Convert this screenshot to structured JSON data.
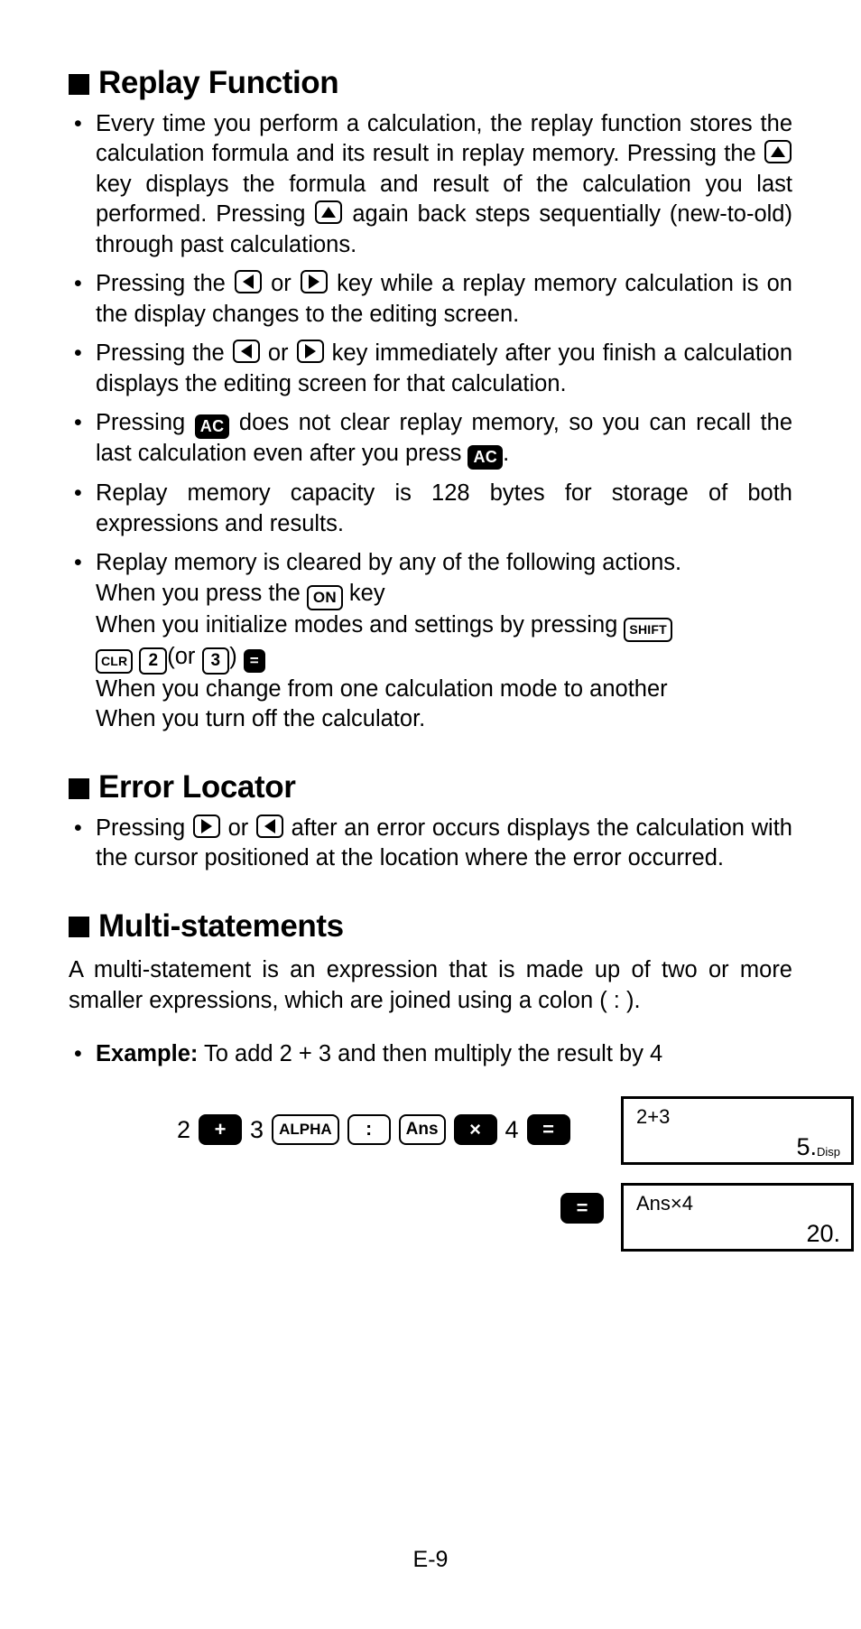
{
  "page": {
    "footer": "E-9"
  },
  "sections": {
    "replay": {
      "heading": "Replay Function",
      "bullets": {
        "b1_p1": "Every time you perform a calculation, the replay function stores the calculation formula and its result in replay memory. Pressing the",
        "b1_p2": "key displays the formula and result of the calculation you last performed. Pressing",
        "b1_p3": "again back steps sequentially (new-to-old) through past calculations.",
        "b2_p1": "Pressing the",
        "b2_or": "or",
        "b2_p2": "key while a replay memory calculation is on the display changes to the editing screen.",
        "b3_p1": "Pressing the",
        "b3_or": "or",
        "b3_p2": "key immediately after you finish a calculation displays the editing screen for that calculation.",
        "b4_p1": "Pressing",
        "b4_p2": "does not clear replay memory, so you can recall the last calculation even after you press",
        "b4_p3": ".",
        "b5": "Replay memory capacity is 128 bytes for storage of both expressions and results.",
        "b6_p1": "Replay memory is cleared by any of the following actions.",
        "b6_l1_p1": "When you press the",
        "b6_l1_p2": "key",
        "b6_l2_p1": "When you initialize modes and settings by pressing",
        "b6_l3_or_open": "(or",
        "b6_l3_or_close": ")",
        "b6_l4": "When you change from one calculation mode to another",
        "b6_l5": "When you turn off the calculator."
      }
    },
    "error_locator": {
      "heading": "Error Locator",
      "bullet_p1": "Pressing",
      "bullet_or": "or",
      "bullet_p2": "after an error occurs displays the calculation with the cursor positioned at the location where the error occurred."
    },
    "multi_statements": {
      "heading": "Multi-statements",
      "paragraph": "A multi-statement is an expression that is made up of two or more smaller expressions, which are joined using a colon ( : ).",
      "example_label": "Example:",
      "example_text": "To add 2 + 3 and then multiply the result by 4"
    }
  },
  "keys": {
    "up": "up-arrow",
    "left": "left-arrow",
    "right": "right-arrow",
    "ac": "AC",
    "on": "ON",
    "shift": "SHIFT",
    "clr": "CLR",
    "two": "2",
    "three": "3",
    "equals": "=",
    "plus": "+",
    "times": "×",
    "alpha": "ALPHA",
    "colon": ":",
    "ans": "Ans",
    "digit_2": "2",
    "digit_3": "3",
    "digit_4": "4"
  },
  "displays": [
    {
      "line1": "2+3",
      "result": "5.",
      "tag": "Disp"
    },
    {
      "line1": "Ans×4",
      "result": "20.",
      "tag": ""
    }
  ],
  "colors": {
    "ink": "#000000",
    "paper": "#ffffff"
  }
}
